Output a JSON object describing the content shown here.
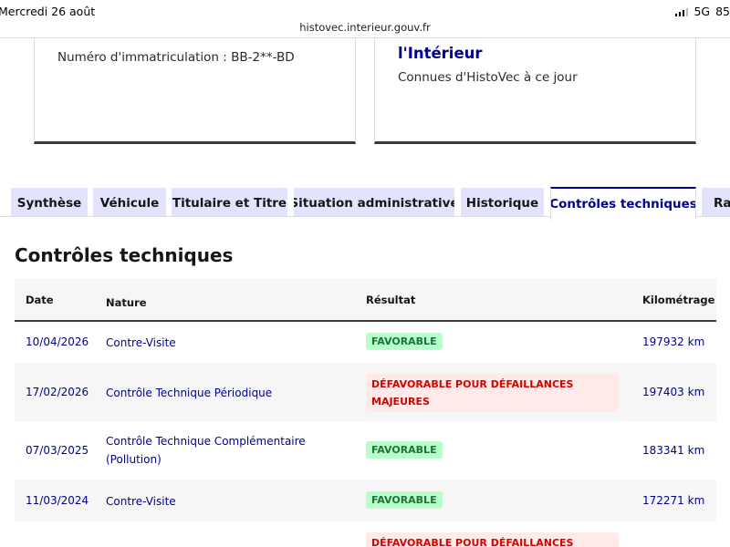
{
  "status_bar": {
    "datetime": "Mercredi 26 août",
    "network": "5G",
    "battery": "85"
  },
  "url": "histovec.interieur.gouv.fr",
  "cards": {
    "left": {
      "text": "Numéro d'immatriculation : BB-2**-BD"
    },
    "right": {
      "title": "l'Intérieur",
      "subtitle": "Connues d'HistoVec à ce jour"
    }
  },
  "tabs": [
    {
      "label": "Synthèse"
    },
    {
      "label": "Véhicule"
    },
    {
      "label": "Titulaire et Titre"
    },
    {
      "label": "Situation administrative"
    },
    {
      "label": "Historique"
    },
    {
      "label": "Contrôles techniques"
    },
    {
      "label": "Rap"
    }
  ],
  "section_title": "Contrôles techniques",
  "table": {
    "headers": {
      "date": "Date",
      "nature": "Nature",
      "result": "Résultat",
      "km": "Kilométrage"
    },
    "rows": [
      {
        "date": "10/04/2026",
        "nature": "Contre-Visite",
        "result": "FAVORABLE",
        "km": "197932 km"
      },
      {
        "date": "17/02/2026",
        "nature": "Contrôle Technique Périodique",
        "result": "DÉFAVORABLE POUR DÉFAILLANCES MAJEURES",
        "km": "197403 km"
      },
      {
        "date": "07/03/2025",
        "nature": "Contrôle Technique Complémentaire (Pollution)",
        "result": "FAVORABLE",
        "km": "183341 km"
      },
      {
        "date": "11/03/2024",
        "nature": "Contre-Visite",
        "result": "FAVORABLE",
        "km": "172271 km"
      },
      {
        "date": "",
        "nature": "",
        "result": "DÉFAVORABLE POUR DÉFAILLANCES",
        "km": ""
      }
    ]
  },
  "colors": {
    "brand_blue": "#000091",
    "tab_bg": "#e3e3fd",
    "favorable_bg": "#b8fec9",
    "favorable_text": "#18753c",
    "defavorable_bg": "#ffe9e9",
    "defavorable_text": "#ce0500"
  }
}
